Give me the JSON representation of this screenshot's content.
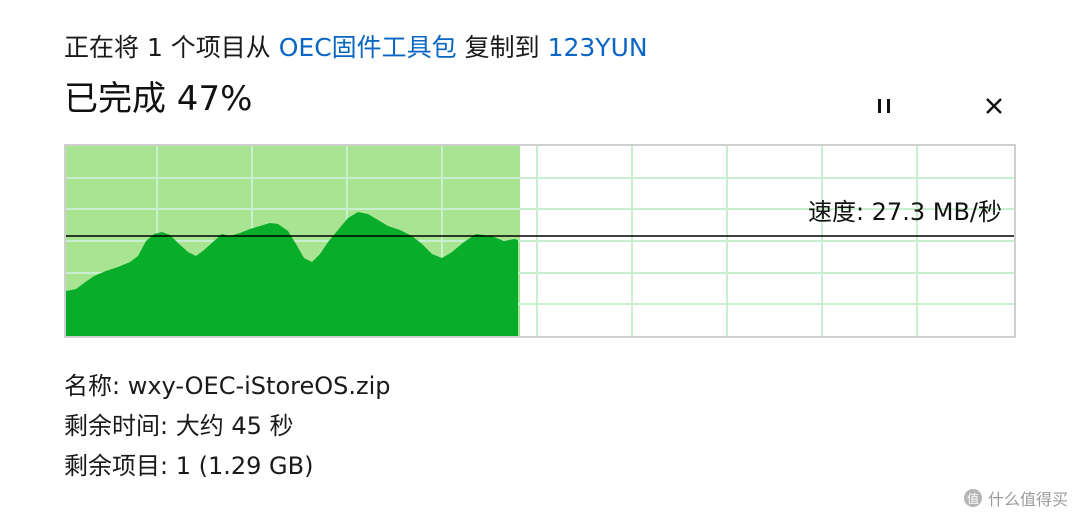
{
  "header": {
    "prefix": "正在将 1 个项目从 ",
    "source": "OEC固件工具包",
    "middle": " 复制到 ",
    "destination": "123YUN"
  },
  "progress": {
    "label": "已完成 47%",
    "fraction": 0.47
  },
  "controls": {
    "pause_icon": "pause-icon",
    "close_icon": "close-icon"
  },
  "speed": {
    "label": "速度: 27.3 MB/秒"
  },
  "details": {
    "name": "名称: wxy-OEC-iStoreOS.zip",
    "time_remaining": "剩余时间: 大约 45 秒",
    "items_remaining": "剩余项目: 1 (1.29 GB)"
  },
  "watermark": {
    "badge": "值",
    "text": "什么值得买"
  },
  "colors": {
    "link": "#0a66c2",
    "progress_fill": "#a8e492",
    "speed_fill": "#08ae2a",
    "grid_line": "#c8efd0",
    "speed_line": "#000000"
  }
}
